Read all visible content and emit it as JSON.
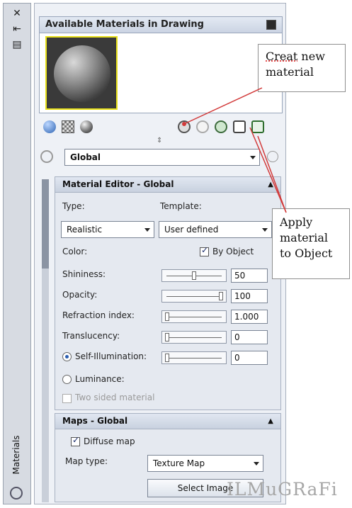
{
  "palette": {
    "title": "Available Materials in Drawing",
    "vertical_tab": "Materials",
    "icons": [
      "close-icon",
      "autohide-icon",
      "properties-icon",
      "globe-icon",
      "checker-icon",
      "material-sphere-icon",
      "create-material-icon",
      "purge-icon",
      "export-icon",
      "apply-material-icon",
      "remove-material-icon"
    ]
  },
  "global_select": {
    "value": "Global"
  },
  "editor": {
    "title": "Material Editor - Global",
    "type_label": "Type:",
    "template_label": "Template:",
    "type_value": "Realistic",
    "template_value": "User defined",
    "color_label": "Color:",
    "by_object_label": "By Object",
    "by_object_checked": true,
    "rows": [
      {
        "label": "Shininess:",
        "value": "50",
        "level": 0.5
      },
      {
        "label": "Opacity:",
        "value": "100",
        "level": 1.0
      },
      {
        "label": "Refraction index:",
        "value": "1.000",
        "level": 0.0
      },
      {
        "label": "Translucency:",
        "value": "0",
        "level": 0.0
      },
      {
        "label": "Self-Illumination:",
        "value": "0",
        "level": 0.0
      }
    ],
    "luminance_label": "Luminance:",
    "two_sided_label": "Two sided material"
  },
  "maps": {
    "title": "Maps - Global",
    "diffuse_label": "Diffuse map",
    "diffuse_checked": true,
    "map_type_label": "Map type:",
    "map_type_value": "Texture Map",
    "select_image_label": "Select Image"
  },
  "callouts": {
    "create_line1": "Creat",
    "create_line1b": " new",
    "create_line2": "material",
    "apply_line1": "Apply",
    "apply_line2": "material",
    "apply_line3": "to Object"
  },
  "watermark": "ILMuGRaFi",
  "colors": {
    "swatch_border": "#e8e11a",
    "arrow": "#d23a3a",
    "panel": "#eef1f6"
  }
}
